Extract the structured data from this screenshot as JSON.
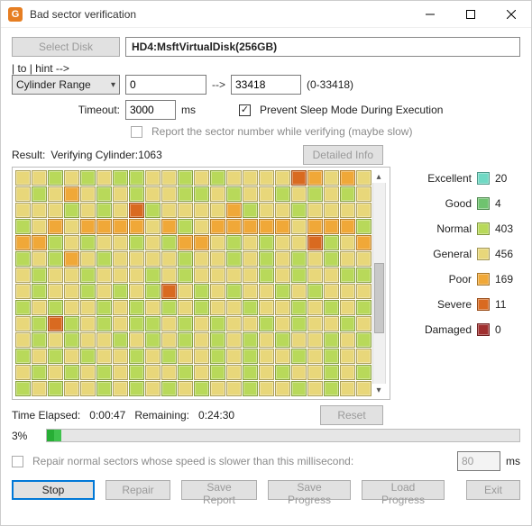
{
  "window": {
    "title": "Bad sector verification"
  },
  "toolbar": {
    "select_disk": "Select Disk",
    "disk_name": "HD4:MsftVirtualDisk(256GB)",
    "range_mode": "Cylinder Range",
    "range_from": "0",
    "arrow": "-->",
    "range_to": "33418",
    "range_hint": "(0-33418)",
    "timeout_label": "Timeout:",
    "timeout_value": "3000",
    "timeout_unit": "ms",
    "prevent_sleep_checked": true,
    "prevent_sleep_label": "Prevent Sleep Mode During Execution",
    "report_sector_checked": false,
    "report_sector_label": "Report the sector number while verifying (maybe slow)"
  },
  "result": {
    "label": "Result:",
    "status": "Verifying Cylinder:1063",
    "detailed_info": "Detailed Info"
  },
  "legend": [
    {
      "name": "Excellent",
      "class": "c-exc",
      "count": "20"
    },
    {
      "name": "Good",
      "class": "c-good",
      "count": "4"
    },
    {
      "name": "Normal",
      "class": "c-norm",
      "count": "403"
    },
    {
      "name": "General",
      "class": "c-gen",
      "count": "456"
    },
    {
      "name": "Poor",
      "class": "c-poor",
      "count": "169"
    },
    {
      "name": "Severe",
      "class": "c-sev",
      "count": "11"
    },
    {
      "name": "Damaged",
      "class": "c-dmg",
      "count": "0"
    }
  ],
  "grid": {
    "cols": 22,
    "rows": 14,
    "cell_classes": [
      "c-gen",
      "c-gen",
      "c-norm",
      "c-gen",
      "c-norm",
      "c-gen",
      "c-norm",
      "c-norm",
      "c-gen",
      "c-gen",
      "c-norm",
      "c-gen",
      "c-norm",
      "c-gen",
      "c-gen",
      "c-gen",
      "c-gen",
      "c-sev",
      "c-poor",
      "c-gen",
      "c-poor",
      "c-gen",
      "c-gen",
      "c-norm",
      "c-gen",
      "c-poor",
      "c-gen",
      "c-norm",
      "c-gen",
      "c-norm",
      "c-gen",
      "c-gen",
      "c-norm",
      "c-norm",
      "c-gen",
      "c-norm",
      "c-gen",
      "c-gen",
      "c-norm",
      "c-gen",
      "c-norm",
      "c-gen",
      "c-norm",
      "c-gen",
      "c-gen",
      "c-gen",
      "c-gen",
      "c-norm",
      "c-gen",
      "c-norm",
      "c-gen",
      "c-sev",
      "c-norm",
      "c-gen",
      "c-gen",
      "c-gen",
      "c-gen",
      "c-poor",
      "c-norm",
      "c-gen",
      "c-gen",
      "c-norm",
      "c-gen",
      "c-gen",
      "c-gen",
      "c-gen",
      "c-norm",
      "c-gen",
      "c-poor",
      "c-gen",
      "c-poor",
      "c-poor",
      "c-poor",
      "c-poor",
      "c-gen",
      "c-poor",
      "c-norm",
      "c-gen",
      "c-poor",
      "c-poor",
      "c-poor",
      "c-poor",
      "c-poor",
      "c-gen",
      "c-poor",
      "c-poor",
      "c-poor",
      "c-norm",
      "c-poor",
      "c-poor",
      "c-norm",
      "c-gen",
      "c-norm",
      "c-gen",
      "c-gen",
      "c-norm",
      "c-gen",
      "c-norm",
      "c-poor",
      "c-poor",
      "c-gen",
      "c-norm",
      "c-gen",
      "c-norm",
      "c-gen",
      "c-gen",
      "c-sev",
      "c-norm",
      "c-gen",
      "c-poor",
      "c-norm",
      "c-gen",
      "c-norm",
      "c-poor",
      "c-gen",
      "c-norm",
      "c-gen",
      "c-gen",
      "c-gen",
      "c-gen",
      "c-norm",
      "c-gen",
      "c-gen",
      "c-norm",
      "c-gen",
      "c-norm",
      "c-gen",
      "c-norm",
      "c-gen",
      "c-norm",
      "c-gen",
      "c-gen",
      "c-gen",
      "c-norm",
      "c-gen",
      "c-gen",
      "c-norm",
      "c-gen",
      "c-gen",
      "c-gen",
      "c-norm",
      "c-gen",
      "c-norm",
      "c-gen",
      "c-gen",
      "c-gen",
      "c-gen",
      "c-norm",
      "c-gen",
      "c-norm",
      "c-gen",
      "c-gen",
      "c-norm",
      "c-norm",
      "c-gen",
      "c-norm",
      "c-gen",
      "c-gen",
      "c-norm",
      "c-gen",
      "c-norm",
      "c-gen",
      "c-norm",
      "c-sev",
      "c-gen",
      "c-norm",
      "c-gen",
      "c-norm",
      "c-gen",
      "c-gen",
      "c-norm",
      "c-gen",
      "c-norm",
      "c-gen",
      "c-gen",
      "c-gen",
      "c-norm",
      "c-gen",
      "c-norm",
      "c-gen",
      "c-gen",
      "c-norm",
      "c-gen",
      "c-norm",
      "c-gen",
      "c-norm",
      "c-gen",
      "c-norm",
      "c-gen",
      "c-gen",
      "c-norm",
      "c-gen",
      "c-gen",
      "c-norm",
      "c-gen",
      "c-norm",
      "c-gen",
      "c-norm",
      "c-gen",
      "c-norm",
      "c-sev",
      "c-norm",
      "c-gen",
      "c-norm",
      "c-gen",
      "c-norm",
      "c-norm",
      "c-gen",
      "c-norm",
      "c-gen",
      "c-norm",
      "c-gen",
      "c-gen",
      "c-norm",
      "c-gen",
      "c-norm",
      "c-gen",
      "c-gen",
      "c-norm",
      "c-gen",
      "c-gen",
      "c-norm",
      "c-gen",
      "c-norm",
      "c-gen",
      "c-gen",
      "c-norm",
      "c-gen",
      "c-norm",
      "c-gen",
      "c-norm",
      "c-gen",
      "c-norm",
      "c-gen",
      "c-norm",
      "c-gen",
      "c-norm",
      "c-gen",
      "c-gen",
      "c-norm",
      "c-gen",
      "c-norm",
      "c-norm",
      "c-gen",
      "c-norm",
      "c-gen",
      "c-norm",
      "c-gen",
      "c-gen",
      "c-norm",
      "c-gen",
      "c-norm",
      "c-gen",
      "c-gen",
      "c-norm",
      "c-gen",
      "c-norm",
      "c-gen",
      "c-gen",
      "c-norm",
      "c-gen",
      "c-norm",
      "c-gen",
      "c-gen",
      "c-gen",
      "c-norm",
      "c-gen",
      "c-norm",
      "c-gen",
      "c-norm",
      "c-gen",
      "c-norm",
      "c-gen",
      "c-gen",
      "c-norm",
      "c-gen",
      "c-norm",
      "c-gen",
      "c-norm",
      "c-gen",
      "c-norm",
      "c-gen",
      "c-gen",
      "c-norm",
      "c-gen",
      "c-norm",
      "c-norm",
      "c-gen",
      "c-norm",
      "c-gen",
      "c-gen",
      "c-norm",
      "c-gen",
      "c-norm",
      "c-gen",
      "c-norm",
      "c-gen",
      "c-norm",
      "c-gen",
      "c-gen",
      "c-norm",
      "c-gen",
      "c-gen",
      "c-norm",
      "c-gen",
      "c-norm",
      "c-gen",
      "c-gen"
    ]
  },
  "status": {
    "elapsed_label": "Time Elapsed:",
    "elapsed": "0:00:47",
    "remaining_label": "Remaining:",
    "remaining": "0:24:30",
    "reset": "Reset",
    "percent_text": "3%",
    "percent_value": 3
  },
  "footer": {
    "repair_chk_label": "Repair normal sectors whose speed is slower than this millisecond:",
    "repair_value": "80",
    "ms": "ms",
    "stop": "Stop",
    "repair": "Repair",
    "save_report": "Save Report",
    "save_progress": "Save Progress",
    "load_progress": "Load Progress",
    "exit": "Exit"
  }
}
